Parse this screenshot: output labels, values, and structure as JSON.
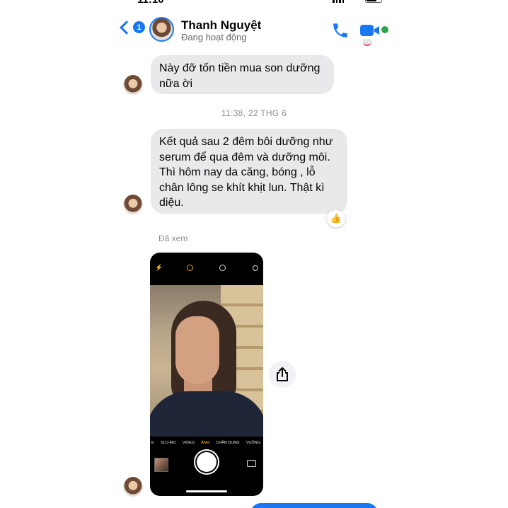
{
  "status_bar": {
    "time": "11:10"
  },
  "header": {
    "back_count": "1",
    "contact_name": "Thanh Nguyệt",
    "contact_status": "Đang hoạt động"
  },
  "messages": [
    {
      "text": "Này đỡ tốn tiền mua son dưỡng nữa ời"
    },
    {
      "text": "Kết quả sau 2 đêm bôi dưỡng như serum để qua đêm và dưỡng môi. Thì hôm nay da căng, bóng , lỗ chân lông se khít khịt lun. Thật kì diệu."
    }
  ],
  "timestamp": "11:38, 22 THG 6",
  "reaction": "👍",
  "seen_label": "Đã xem",
  "camera_modes": [
    "E",
    "SLO-MO",
    "VIDEO",
    "ẢNH",
    "CHÂN DUNG",
    "VUÔNG"
  ],
  "camera_active_mode": "ẢNH",
  "colors": {
    "accent": "#1877f2",
    "bubble": "#e9e9eb",
    "active": "#31a24c"
  }
}
